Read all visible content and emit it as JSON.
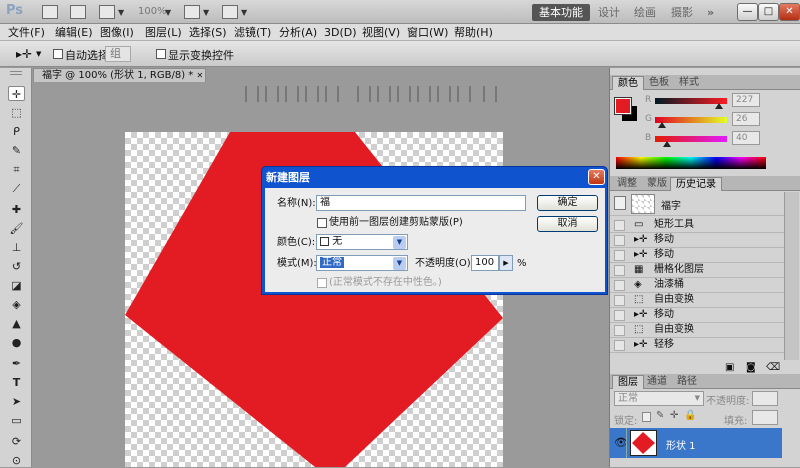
{
  "app": {
    "logo": "Ps",
    "zoom": "100%"
  },
  "workspaces": {
    "basic": "基本功能",
    "design": "设计",
    "paint": "绘画",
    "photo": "摄影",
    "more": "»"
  },
  "window_controls": {
    "minimize": "—",
    "restore": "□",
    "close": "✕"
  },
  "menu": [
    "文件(F)",
    "编辑(E)",
    "图像(I)",
    "图层(L)",
    "选择(S)",
    "滤镜(T)",
    "分析(A)",
    "3D(D)",
    "视图(V)",
    "窗口(W)",
    "帮助(H)"
  ],
  "options": {
    "auto_select_label": "自动选择:",
    "auto_select_value": "组",
    "show_transform_label": "显示变换控件"
  },
  "document": {
    "tab_title": "福字 @ 100% (形状 1, RGB/8) * ",
    "tab_close": "✕"
  },
  "color_panel": {
    "tabs": [
      "颜色",
      "色板",
      "样式"
    ],
    "foreground": "#e31b23",
    "background": "#000000",
    "channels": [
      {
        "label": "R",
        "value": "227",
        "level": 0.89,
        "gradient": "linear-gradient(90deg,#001b23,#ff1b23)"
      },
      {
        "label": "G",
        "value": "26",
        "level": 0.1,
        "gradient": "linear-gradient(90deg,#e30023,#e3ff23)"
      },
      {
        "label": "B",
        "value": "40",
        "level": 0.16,
        "gradient": "linear-gradient(90deg,#e31b00,#e31bff)"
      }
    ]
  },
  "history_panel": {
    "tabs": [
      "调整",
      "蒙版",
      "历史记录"
    ],
    "snapshot_label": "福字",
    "steps": [
      {
        "icon": "rect",
        "label": "矩形工具"
      },
      {
        "icon": "move",
        "label": "移动"
      },
      {
        "icon": "move",
        "label": "移动"
      },
      {
        "icon": "rasterize",
        "label": "栅格化图层"
      },
      {
        "icon": "bucket",
        "label": "油漆桶"
      },
      {
        "icon": "transform",
        "label": "自由变换"
      },
      {
        "icon": "move",
        "label": "移动"
      },
      {
        "icon": "transform",
        "label": "自由变换"
      },
      {
        "icon": "nudge",
        "label": "轻移"
      }
    ]
  },
  "layers_panel": {
    "tabs": [
      "图层",
      "通道",
      "路径"
    ],
    "blend_mode": "正常",
    "opacity_label": "不透明度:",
    "lock_label": "锁定:",
    "fill_label": "填充:",
    "layer_name": "形状 1",
    "selected_color": "#3a76c9"
  },
  "dialog": {
    "title": "新建图层",
    "close": "✕",
    "name_label": "名称(N):",
    "name_value": "福",
    "clip_mask_label": "使用前一图层创建剪贴蒙版(P)",
    "color_label": "颜色(C):",
    "color_value": "无",
    "mode_label": "模式(M):",
    "mode_value": "正常",
    "opacity_label": "不透明度(O):",
    "opacity_value": "100",
    "opacity_unit": "%",
    "neutral_label": "(正常模式不存在中性色。)",
    "ok": "确定",
    "cancel": "取消"
  }
}
